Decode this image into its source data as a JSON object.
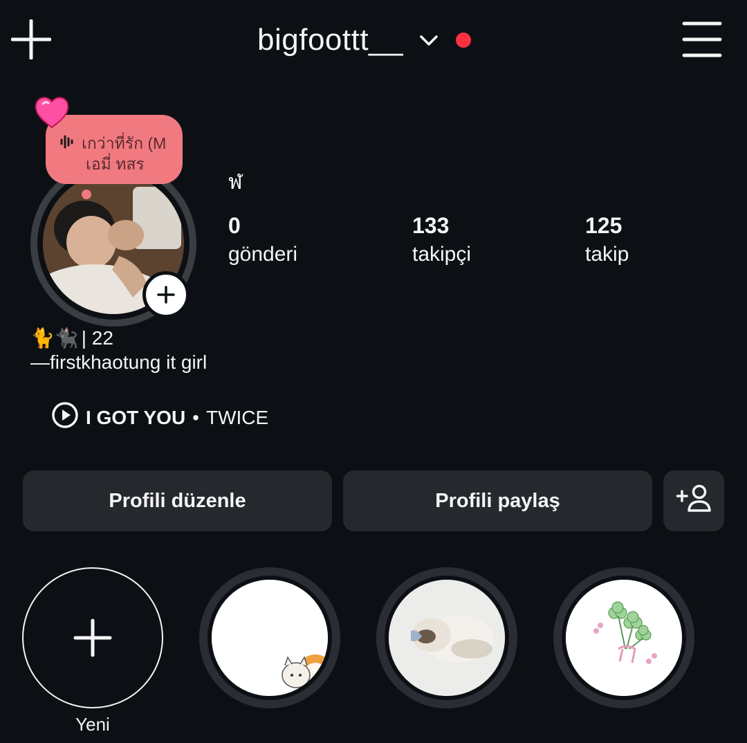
{
  "header": {
    "username": "bigfoottt__",
    "icons": {
      "create": "plus-icon",
      "switch_account": "chevron-down-icon",
      "notification": "red-dot",
      "menu": "hamburger-menu-icon"
    }
  },
  "note": {
    "line1": "เกว่าที่รัก (M",
    "line2": "เอมี่ ทสร",
    "icon": "audio-wave-icon",
    "heart_emoji": "💗"
  },
  "profile": {
    "name": "ฬ",
    "stats": [
      {
        "value": "0",
        "label": "gönderi"
      },
      {
        "value": "133",
        "label": "takipçi"
      },
      {
        "value": "125",
        "label": "takip"
      }
    ],
    "bio_line1_emoji": "🐈🐈‍⬛",
    "bio_line1_text": "| 22",
    "bio_line2": "—firstkhaotung it girl",
    "music": {
      "title": "I GOT YOU",
      "separator": "•",
      "artist": "TWICE"
    }
  },
  "buttons": {
    "edit_profile": "Profili düzenle",
    "share_profile": "Profili paylaş",
    "add_user_icon": "add-person-icon"
  },
  "highlights": {
    "new_label": "Yeni"
  },
  "colors": {
    "background": "#0c1014",
    "button_bg": "#25292e",
    "note_bg": "#f07a80",
    "notification_dot": "#ff3040"
  }
}
